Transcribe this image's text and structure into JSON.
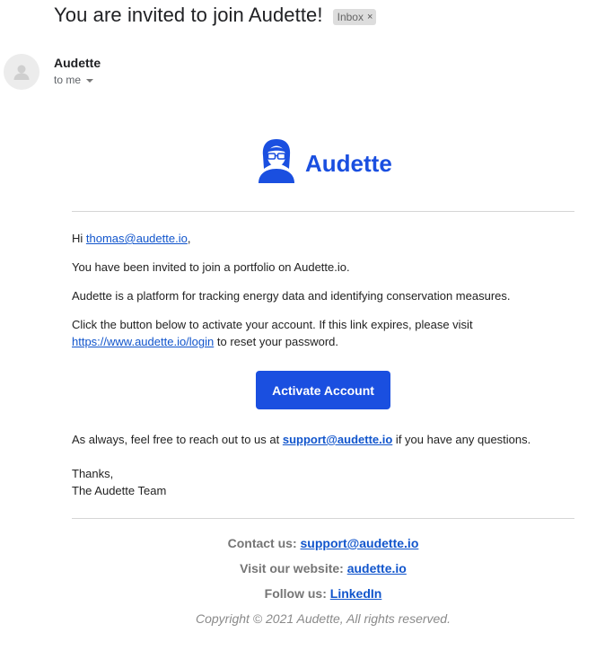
{
  "email": {
    "subject": "You are invited to join Audette!",
    "label": "Inbox",
    "label_remove": "×",
    "sender": "Audette",
    "recipient": "to me"
  },
  "brand": {
    "name": "Audette",
    "color": "#1a4fe0"
  },
  "message": {
    "greeting_prefix": "Hi ",
    "greeting_email": "thomas@audette.io",
    "greeting_suffix": ",",
    "p_invited": "You have been invited to join a portfolio on Audette.io.",
    "p_platform": "Audette is a platform for tracking energy data and identifying conservation measures.",
    "p_activate_text": "Click the button below to activate your account. If this link expires, please visit",
    "p_activate_link": "https://www.audette.io/login",
    "p_activate_suffix": " to reset your password.",
    "cta_label": "Activate Account",
    "p_support_prefix": "As always, feel free to reach out to us at ",
    "p_support_link": "support@audette.io",
    "p_support_suffix": " if you have any questions.",
    "signoff": "Thanks,",
    "signature": "The Audette Team"
  },
  "footer": {
    "contact_label": "Contact us: ",
    "contact_link": "support@audette.io",
    "website_label": "Visit our website: ",
    "website_link": "audette.io",
    "follow_label": "Follow us: ",
    "follow_link": "LinkedIn",
    "copyright": "Copyright © 2021 Audette, All rights reserved."
  },
  "icons": {
    "avatar": "person-icon",
    "brand_logo": "audette-logo-icon",
    "dropdown": "caret-down-icon",
    "close": "close-icon"
  }
}
